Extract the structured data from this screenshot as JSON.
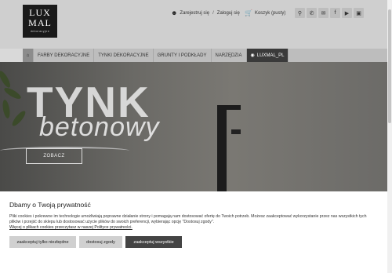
{
  "logo": {
    "line1": "LUX",
    "line2": "MAL",
    "tagline": "dekoracyjne"
  },
  "topbar": {
    "register": "Zarejestruj się",
    "separator": "/",
    "login": "Zaloguj się",
    "cart": "Koszyk (pusty)"
  },
  "social": [
    "search-icon",
    "phone-icon",
    "mail-icon",
    "facebook-icon",
    "youtube-icon",
    "instagram-icon"
  ],
  "nav": {
    "items": [
      {
        "label": "FARBY DEKORACYJNE"
      },
      {
        "label": "TYNKI DEKORACYJNE"
      },
      {
        "label": "GRUNTY I PODKŁADY"
      },
      {
        "label": "NARZĘDZIA"
      },
      {
        "label": "LUXMAL_PL"
      }
    ]
  },
  "hero": {
    "title": "TYNK",
    "subtitle": "betonowy",
    "button": "ZOBACZ"
  },
  "cookie": {
    "title": "Dbamy o Twoją prywatność",
    "body": "Pliki cookies i pokrewne im technologie umożliwiają poprawne działanie strony i pomagają nam dostosować ofertę do Twoich potrzeb. Możesz zaakceptować wykorzystanie przez nas wszystkich tych plików i przejść do sklepu lub dostosować użycie plików do swoich preferencji, wybierając opcję \"Dostosuj zgody\".",
    "policy_link": "Więcej o plikach cookies przeczytasz w naszej Polityce prywatności.",
    "btn_necessary": "zaakceptuj tylko niezbędne",
    "btn_customize": "dostosuj zgody",
    "btn_all": "zaakceptuj wszystkie"
  }
}
